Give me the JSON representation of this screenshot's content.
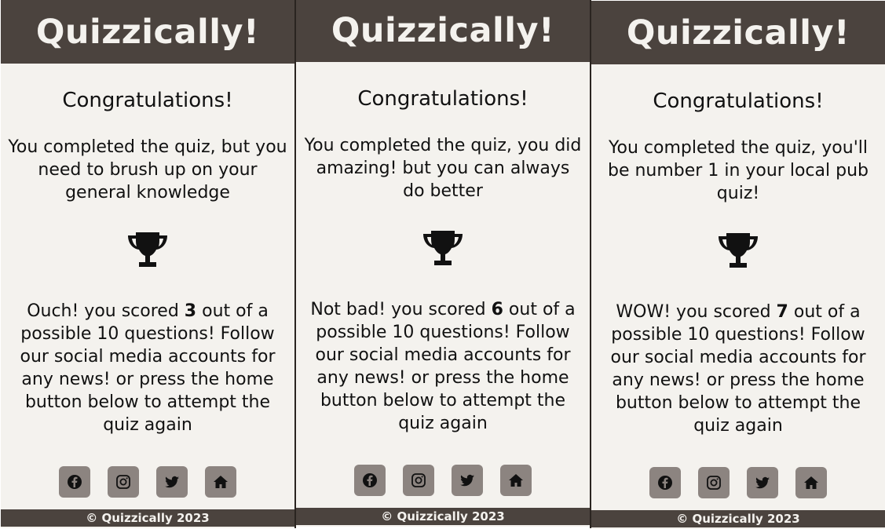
{
  "colors": {
    "header_bg": "#4b433e",
    "page_bg": "#f4f2ee",
    "icon_bg": "#8c8480",
    "text": "#111111"
  },
  "panels": [
    {
      "title": "Quizzically!",
      "heading": "Congratulations!",
      "message": "You completed the quiz, but you need to brush up on your general knowledge",
      "result_prefix": "Ouch! you scored ",
      "score": "3",
      "result_suffix": " out of a possible 10 questions! Follow our social media accounts for any news! or press the home button below to attempt the quiz again",
      "footer": "© Quizzically 2023"
    },
    {
      "title": "Quizzically!",
      "heading": "Congratulations!",
      "message": "You completed the quiz, you did amazing! but you can always do better",
      "result_prefix": "Not bad! you scored ",
      "score": "6",
      "result_suffix": " out of a possible 10 questions! Follow our social media accounts for any news! or press the home button below to attempt the quiz again",
      "footer": "© Quizzically 2023"
    },
    {
      "title": "Quizzically!",
      "heading": "Congratulations!",
      "message": "You completed the quiz, you'll be number 1 in your local pub quiz!",
      "result_prefix": "WOW! you scored ",
      "score": "7",
      "result_suffix": " out of a possible 10 questions! Follow our social media accounts for any news! or press the home button below to attempt the quiz again",
      "footer": "© Quizzically 2023"
    }
  ],
  "icons": [
    "trophy-icon",
    "facebook-icon",
    "instagram-icon",
    "twitter-icon",
    "home-icon"
  ]
}
